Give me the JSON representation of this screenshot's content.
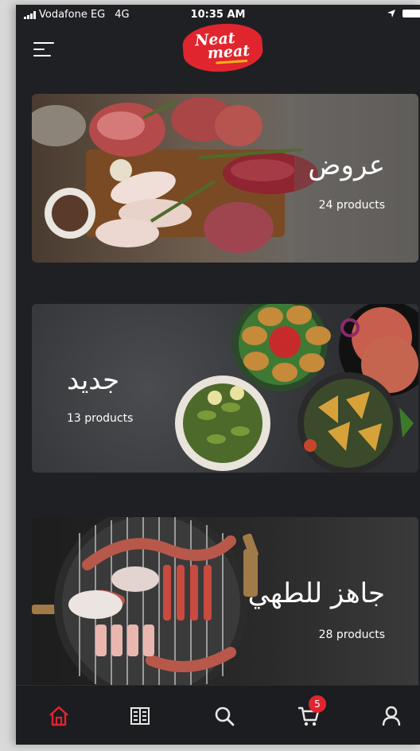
{
  "status_bar": {
    "carrier": "Vodafone EG",
    "network": "4G",
    "time": "10:35 AM"
  },
  "header": {
    "logo_line1": "Neat",
    "logo_line2": "meat"
  },
  "categories": [
    {
      "title": "عروض",
      "count": "24 products"
    },
    {
      "title": "جديد",
      "count": "13 products"
    },
    {
      "title": "جاهز للطهي",
      "count": "28 products"
    }
  ],
  "nav": {
    "active": "home",
    "cart_count": "5"
  },
  "colors": {
    "accent": "#e1252e",
    "background": "#1f2023",
    "icon": "#e8e8e8",
    "logo_underline": "#f6b21b"
  }
}
